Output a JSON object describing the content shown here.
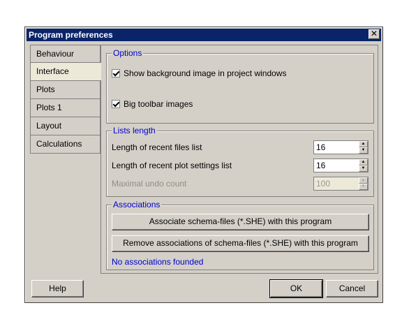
{
  "window": {
    "title": "Program preferences",
    "close_glyph": "✕"
  },
  "tabs": [
    {
      "label": "Behaviour"
    },
    {
      "label": "Interface"
    },
    {
      "label": "Plots"
    },
    {
      "label": "Plots 1"
    },
    {
      "label": "Layout"
    },
    {
      "label": "Calculations"
    }
  ],
  "active_tab": "Interface",
  "options": {
    "legend": "Options",
    "show_bg_image": {
      "label": "Show background image in project windows",
      "checked": true
    },
    "big_toolbar": {
      "label": "Big toolbar images",
      "checked": true
    }
  },
  "lists_length": {
    "legend": "Lists length",
    "recent_files": {
      "label": "Length of recent files list",
      "value": "16"
    },
    "recent_plot_settings": {
      "label": "Length of recent plot settings list",
      "value": "16"
    },
    "max_undo": {
      "label": "Maximal undo count",
      "value": "100",
      "enabled": false
    }
  },
  "associations": {
    "legend": "Associations",
    "associate_button": "Associate schema-files (*.SHE) with this program",
    "remove_button": "Remove associations of schema-files (*.SHE) with this program",
    "status": "No associations founded"
  },
  "footer": {
    "help": "Help",
    "ok": "OK",
    "cancel": "Cancel"
  },
  "colors": {
    "title_bar": "#0a246a",
    "group_legend": "#0000cc",
    "face": "#d4d0c8"
  }
}
